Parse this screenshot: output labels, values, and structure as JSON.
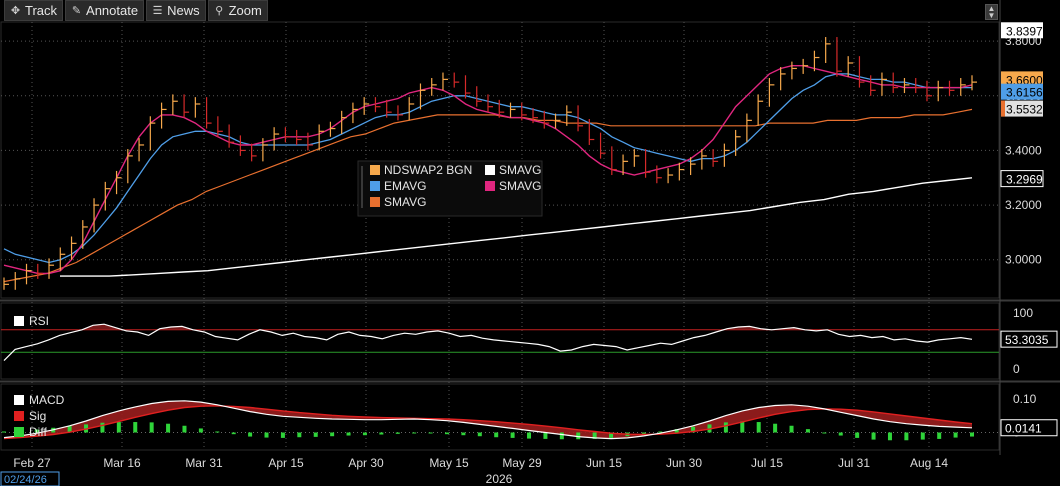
{
  "toolbar": {
    "buttons": [
      {
        "icon": "crosshair-icon",
        "glyph": "✥",
        "label": "Track"
      },
      {
        "icon": "pencil-icon",
        "glyph": "✎",
        "label": "Annotate"
      },
      {
        "icon": "news-icon",
        "glyph": "☰",
        "label": "News"
      },
      {
        "icon": "magnifier-icon",
        "glyph": "⚲",
        "label": "Zoom"
      }
    ]
  },
  "chart_data": [
    {
      "type": "line",
      "panel": "price",
      "y_ticks": [
        "3.0000",
        "3.2000",
        "3.4000",
        "3.6000",
        "3.8000"
      ],
      "ylim": [
        2.86,
        3.87
      ],
      "price_tags": [
        {
          "value": 3.8397,
          "label": "3.8397",
          "color": "#ffffff",
          "text_color": "#000000",
          "style": "box"
        },
        {
          "value": 3.66,
          "label": "3.6600",
          "color": "#f7a94c",
          "text_color": "#000000",
          "style": "box"
        },
        {
          "value": 3.615,
          "label": "3.6156",
          "color": "#4f9ee8",
          "text_color": "#000000",
          "style": "box"
        },
        {
          "value": 3.5532,
          "label": "3.5532",
          "color": "#e0e0e0",
          "text_color": "#000000",
          "style": "box",
          "marker_color": "#e8702f"
        },
        {
          "value": 3.2969,
          "label": "3.2969",
          "color": "#ffffff",
          "text_color": "#ffffff",
          "style": "outline"
        }
      ],
      "legend": [
        {
          "name": "NDSWAP2 BGN",
          "color": "#f7a94c"
        },
        {
          "name": "SMAVG",
          "color": "#ffffff"
        },
        {
          "name": "EMAVG",
          "color": "#4f9ee8"
        },
        {
          "name": "SMAVG",
          "color": "#e0267f"
        },
        {
          "name": "SMAVG",
          "color": "#e8702f"
        }
      ],
      "series": [
        {
          "role": "price",
          "color": "#f7a94c",
          "values": [
            2.91,
            2.93,
            2.96,
            2.95,
            2.98,
            3.02,
            3.06,
            3.12,
            3.2,
            3.26,
            3.3,
            3.38,
            3.42,
            3.5,
            3.55,
            3.58,
            3.54,
            3.57,
            3.5,
            3.47,
            3.43,
            3.4,
            3.38,
            3.42,
            3.46,
            3.45,
            3.44,
            3.42,
            3.47,
            3.48,
            3.52,
            3.55,
            3.57,
            3.56,
            3.54,
            3.53,
            3.57,
            3.62,
            3.64,
            3.66,
            3.65,
            3.61,
            3.58,
            3.56,
            3.54,
            3.55,
            3.53,
            3.52,
            3.5,
            3.51,
            3.54,
            3.49,
            3.44,
            3.39,
            3.33,
            3.36,
            3.38,
            3.32,
            3.3,
            3.31,
            3.33,
            3.35,
            3.38,
            3.36,
            3.4,
            3.45,
            3.51,
            3.58,
            3.64,
            3.68,
            3.7,
            3.71,
            3.74,
            3.79,
            3.69,
            3.72,
            3.65,
            3.62,
            3.66,
            3.63,
            3.64,
            3.63,
            3.6,
            3.63,
            3.62,
            3.64,
            3.65
          ]
        },
        {
          "role": "ema",
          "color": "#4f9ee8",
          "values": [
            3.04,
            3.02,
            3.01,
            3.0,
            2.99,
            3.0,
            3.02,
            3.05,
            3.09,
            3.14,
            3.19,
            3.25,
            3.31,
            3.37,
            3.42,
            3.45,
            3.46,
            3.47,
            3.47,
            3.46,
            3.45,
            3.43,
            3.42,
            3.42,
            3.42,
            3.42,
            3.42,
            3.42,
            3.43,
            3.44,
            3.46,
            3.48,
            3.5,
            3.52,
            3.53,
            3.53,
            3.54,
            3.56,
            3.58,
            3.59,
            3.6,
            3.6,
            3.59,
            3.58,
            3.57,
            3.56,
            3.56,
            3.55,
            3.54,
            3.53,
            3.53,
            3.52,
            3.5,
            3.48,
            3.45,
            3.43,
            3.41,
            3.4,
            3.39,
            3.38,
            3.37,
            3.36,
            3.37,
            3.37,
            3.38,
            3.4,
            3.43,
            3.47,
            3.51,
            3.55,
            3.59,
            3.62,
            3.64,
            3.67,
            3.68,
            3.68,
            3.67,
            3.66,
            3.66,
            3.65,
            3.65,
            3.64,
            3.63,
            3.63,
            3.63,
            3.63,
            3.63
          ]
        },
        {
          "role": "sma_fast",
          "color": "#e0267f",
          "values": [
            2.98,
            2.97,
            2.96,
            2.95,
            2.95,
            2.96,
            3.0,
            3.06,
            3.14,
            3.22,
            3.3,
            3.38,
            3.45,
            3.5,
            3.53,
            3.53,
            3.52,
            3.5,
            3.47,
            3.45,
            3.43,
            3.42,
            3.42,
            3.43,
            3.44,
            3.45,
            3.45,
            3.45,
            3.46,
            3.48,
            3.51,
            3.54,
            3.56,
            3.57,
            3.58,
            3.59,
            3.61,
            3.62,
            3.63,
            3.62,
            3.6,
            3.57,
            3.55,
            3.54,
            3.53,
            3.52,
            3.52,
            3.51,
            3.5,
            3.48,
            3.45,
            3.42,
            3.38,
            3.35,
            3.33,
            3.32,
            3.31,
            3.32,
            3.33,
            3.34,
            3.35,
            3.37,
            3.4,
            3.44,
            3.5,
            3.56,
            3.6,
            3.64,
            3.68,
            3.7,
            3.71,
            3.71,
            3.7,
            3.69,
            3.68,
            3.67,
            3.66,
            3.65,
            3.64,
            3.64,
            3.63,
            3.63,
            3.63,
            3.63,
            3.63,
            3.63,
            3.64
          ]
        },
        {
          "role": "sma_mid",
          "color": "#e8702f",
          "values": [
            2.92,
            2.93,
            2.94,
            2.95,
            2.97,
            2.99,
            3.02,
            3.05,
            3.08,
            3.11,
            3.14,
            3.17,
            3.2,
            3.22,
            3.25,
            3.27,
            3.29,
            3.31,
            3.33,
            3.35,
            3.37,
            3.39,
            3.41,
            3.43,
            3.45,
            3.46,
            3.48,
            3.5,
            3.51,
            3.52,
            3.53,
            3.53,
            3.53,
            3.53,
            3.53,
            3.52,
            3.52,
            3.51,
            3.51,
            3.5,
            3.5,
            3.5,
            3.49,
            3.49,
            3.49,
            3.49,
            3.49,
            3.49,
            3.49,
            3.49,
            3.49,
            3.49,
            3.49,
            3.5,
            3.5,
            3.5,
            3.5,
            3.51,
            3.51,
            3.51,
            3.52,
            3.52,
            3.52,
            3.53,
            3.53,
            3.53,
            3.54,
            3.55
          ]
        },
        {
          "role": "sma_slow",
          "color": "#ffffff",
          "values": [
            2.94,
            2.94,
            2.94,
            2.945,
            2.95,
            2.955,
            2.96,
            2.97,
            2.98,
            2.99,
            3.0,
            3.01,
            3.02,
            3.03,
            3.04,
            3.05,
            3.06,
            3.07,
            3.08,
            3.09,
            3.1,
            3.11,
            3.12,
            3.13,
            3.14,
            3.15,
            3.16,
            3.17,
            3.18,
            3.195,
            3.21,
            3.22,
            3.24,
            3.25,
            3.265,
            3.28,
            3.29,
            3.3
          ]
        }
      ]
    },
    {
      "type": "line",
      "panel": "rsi",
      "legend": [
        {
          "name": "RSI",
          "color": "#ffffff"
        }
      ],
      "y_ticks": [
        "100",
        "0"
      ],
      "ylim": [
        0,
        100
      ],
      "thresholds": [
        {
          "value": 70,
          "color": "#c22121"
        },
        {
          "value": 30,
          "color": "#2a9a2a"
        }
      ],
      "last_value": "53.3035",
      "series": [
        {
          "name": "RSI",
          "color": "#ffffff",
          "values": [
            15,
            35,
            40,
            45,
            52,
            60,
            65,
            70,
            78,
            80,
            74,
            68,
            66,
            60,
            72,
            75,
            76,
            70,
            66,
            58,
            55,
            52,
            62,
            70,
            66,
            60,
            64,
            58,
            56,
            52,
            62,
            66,
            60,
            58,
            54,
            60,
            64,
            62,
            66,
            68,
            64,
            58,
            60,
            55,
            52,
            50,
            48,
            46,
            44,
            40,
            32,
            34,
            40,
            44,
            42,
            40,
            34,
            38,
            42,
            46,
            44,
            50,
            56,
            60,
            66,
            72,
            75,
            76,
            72,
            70,
            72,
            74,
            70,
            68,
            70,
            62,
            58,
            60,
            56,
            58,
            52,
            54,
            50,
            48,
            52,
            54,
            56,
            53
          ]
        }
      ]
    },
    {
      "type": "area",
      "panel": "macd",
      "legend": [
        {
          "name": "MACD",
          "color": "#ffffff"
        },
        {
          "name": "Sig",
          "color": "#e02020"
        },
        {
          "name": "Diff",
          "color": "#2fd43a"
        }
      ],
      "y_ticks": [
        "0.10",
        "0"
      ],
      "ylim": [
        -0.04,
        0.12
      ],
      "last_value": "0.0141",
      "series": [
        {
          "name": "MACD",
          "color": "#ffffff",
          "values": [
            -0.015,
            -0.01,
            -0.002,
            0.008,
            0.02,
            0.034,
            0.05,
            0.064,
            0.076,
            0.086,
            0.092,
            0.094,
            0.09,
            0.082,
            0.072,
            0.062,
            0.054,
            0.048,
            0.045,
            0.042,
            0.04,
            0.039,
            0.038,
            0.038,
            0.039,
            0.04,
            0.038,
            0.035,
            0.03,
            0.024,
            0.018,
            0.012,
            0.006,
            0.0,
            -0.006,
            -0.012,
            -0.016,
            -0.018,
            -0.016,
            -0.01,
            -0.002,
            0.008,
            0.02,
            0.034,
            0.05,
            0.064,
            0.074,
            0.08,
            0.082,
            0.078,
            0.07,
            0.06,
            0.05,
            0.04,
            0.032,
            0.026,
            0.022,
            0.018,
            0.016,
            0.014
          ]
        },
        {
          "name": "Sig",
          "color": "#e02020",
          "values": [
            -0.018,
            -0.015,
            -0.011,
            -0.006,
            0.001,
            0.01,
            0.021,
            0.033,
            0.045,
            0.056,
            0.066,
            0.074,
            0.078,
            0.079,
            0.077,
            0.074,
            0.069,
            0.064,
            0.059,
            0.055,
            0.051,
            0.048,
            0.046,
            0.044,
            0.043,
            0.042,
            0.041,
            0.04,
            0.038,
            0.035,
            0.032,
            0.028,
            0.024,
            0.019,
            0.014,
            0.008,
            0.003,
            -0.002,
            -0.005,
            -0.006,
            -0.005,
            -0.002,
            0.003,
            0.01,
            0.02,
            0.031,
            0.043,
            0.054,
            0.062,
            0.068,
            0.07,
            0.069,
            0.066,
            0.061,
            0.055,
            0.049,
            0.043,
            0.037,
            0.031,
            0.026
          ]
        },
        {
          "name": "Diff",
          "color": "#2fd43a",
          "values": [
            0.003,
            0.005,
            0.009,
            0.014,
            0.019,
            0.024,
            0.029,
            0.031,
            0.031,
            0.03,
            0.026,
            0.02,
            0.012,
            0.003,
            -0.005,
            -0.012,
            -0.015,
            -0.016,
            -0.014,
            -0.013,
            -0.011,
            -0.009,
            -0.008,
            -0.006,
            -0.004,
            -0.002,
            -0.003,
            -0.005,
            -0.008,
            -0.011,
            -0.014,
            -0.016,
            -0.018,
            -0.019,
            -0.02,
            -0.02,
            -0.019,
            -0.016,
            -0.011,
            -0.004,
            0.003,
            0.01,
            0.017,
            0.024,
            0.03,
            0.033,
            0.031,
            0.026,
            0.02,
            0.01,
            0.0,
            -0.009,
            -0.016,
            -0.021,
            -0.023,
            -0.023,
            -0.021,
            -0.019,
            -0.015,
            -0.012
          ]
        }
      ]
    }
  ],
  "x_axis": {
    "ticks": [
      "Feb 27",
      "Mar 16",
      "Mar 31",
      "Apr 15",
      "Apr 30",
      "May 15",
      "May 29",
      "Jun 15",
      "Jun 30",
      "Jul 15",
      "Jul 31",
      "Aug 14"
    ],
    "start_date": "02/24/26",
    "year": "2026"
  }
}
